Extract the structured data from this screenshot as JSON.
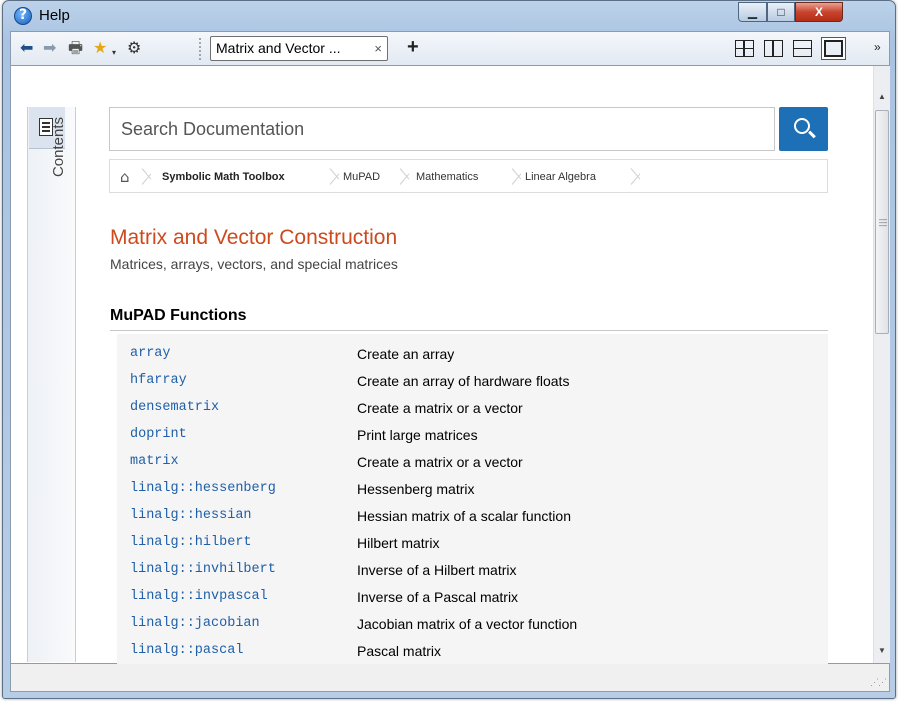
{
  "window": {
    "title": "Help",
    "min_label": "▭",
    "max_label": "▣",
    "close_label": "X"
  },
  "toolbar": {
    "tab_label": "Matrix and Vector ...",
    "tab_close": "×",
    "new_tab": "+",
    "overflow": "»"
  },
  "sidebar": {
    "contents_label": "Contents"
  },
  "search": {
    "placeholder": "Search Documentation"
  },
  "breadcrumb": [
    "Symbolic Math Toolbox",
    "MuPAD",
    "Mathematics",
    "Linear Algebra"
  ],
  "page": {
    "title": "Matrix and Vector Construction",
    "subtitle": "Matrices, arrays, vectors, and special matrices",
    "section": "MuPAD Functions"
  },
  "functions": [
    {
      "name": "array",
      "desc": "Create an array"
    },
    {
      "name": "hfarray",
      "desc": "Create an array of hardware floats"
    },
    {
      "name": "densematrix",
      "desc": "Create a matrix or a vector"
    },
    {
      "name": "doprint",
      "desc": "Print large matrices"
    },
    {
      "name": "matrix",
      "desc": "Create a matrix or a vector"
    },
    {
      "name": "linalg::hessenberg",
      "desc": "Hessenberg matrix"
    },
    {
      "name": "linalg::hessian",
      "desc": "Hessian matrix of a scalar function"
    },
    {
      "name": "linalg::hilbert",
      "desc": "Hilbert matrix"
    },
    {
      "name": "linalg::invhilbert",
      "desc": "Inverse of a Hilbert matrix"
    },
    {
      "name": "linalg::invpascal",
      "desc": "Inverse of a Pascal matrix"
    },
    {
      "name": "linalg::jacobian",
      "desc": "Jacobian matrix of a vector function"
    },
    {
      "name": "linalg::pascal",
      "desc": "Pascal matrix"
    }
  ],
  "colors": {
    "title": "#cc4a1d",
    "link": "#1f5fa8",
    "search_button": "#1d6fb6"
  }
}
